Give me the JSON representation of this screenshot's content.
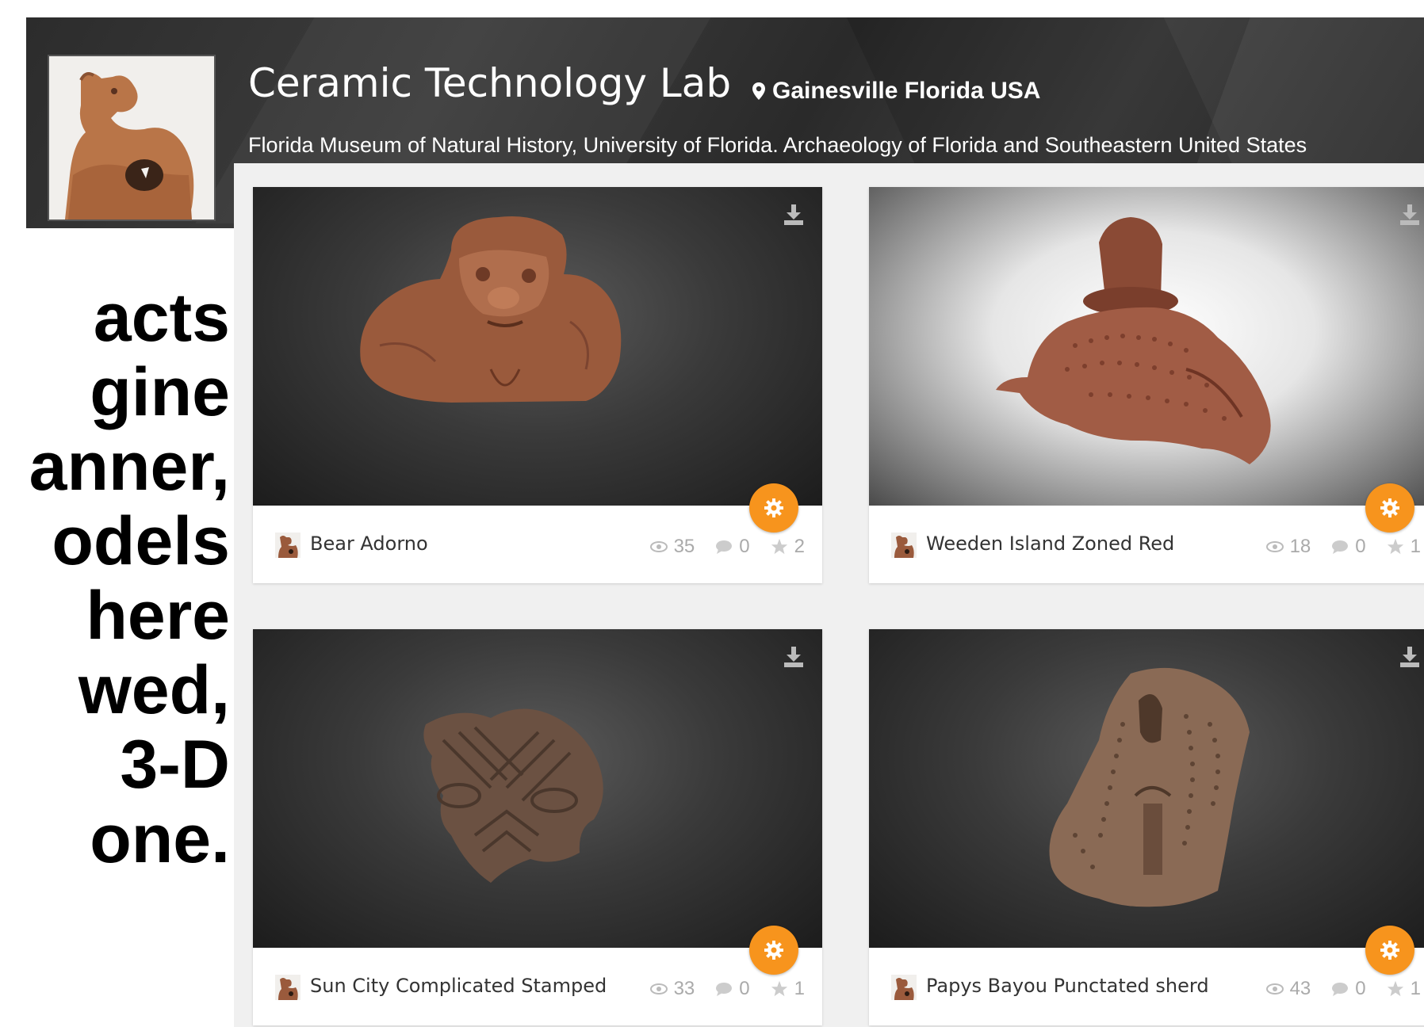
{
  "slide": {
    "lines": [
      "acts",
      "gine",
      "anner,",
      "odels",
      "here",
      "wed,",
      "3-D",
      "one."
    ]
  },
  "header": {
    "title": "Ceramic Technology Lab",
    "location": "Gainesville Florida USA",
    "subtitle": "Florida Museum of Natural History, University of Florida. Archaeology of Florida and Southeastern United States"
  },
  "colors": {
    "accent": "#f7941d",
    "header_bg": "#2f2f2f"
  },
  "models": [
    {
      "name": "Bear Adorno",
      "views": "35",
      "comments": "0",
      "likes": "2",
      "background": "dark"
    },
    {
      "name": "Weeden Island Zoned Red",
      "views": "18",
      "comments": "0",
      "likes": "1",
      "background": "light"
    },
    {
      "name": "Sun City Complicated Stamped",
      "views": "33",
      "comments": "0",
      "likes": "1",
      "background": "dark"
    },
    {
      "name": "Papys Bayou Punctated sherd",
      "views": "43",
      "comments": "0",
      "likes": "1",
      "background": "dark"
    }
  ]
}
